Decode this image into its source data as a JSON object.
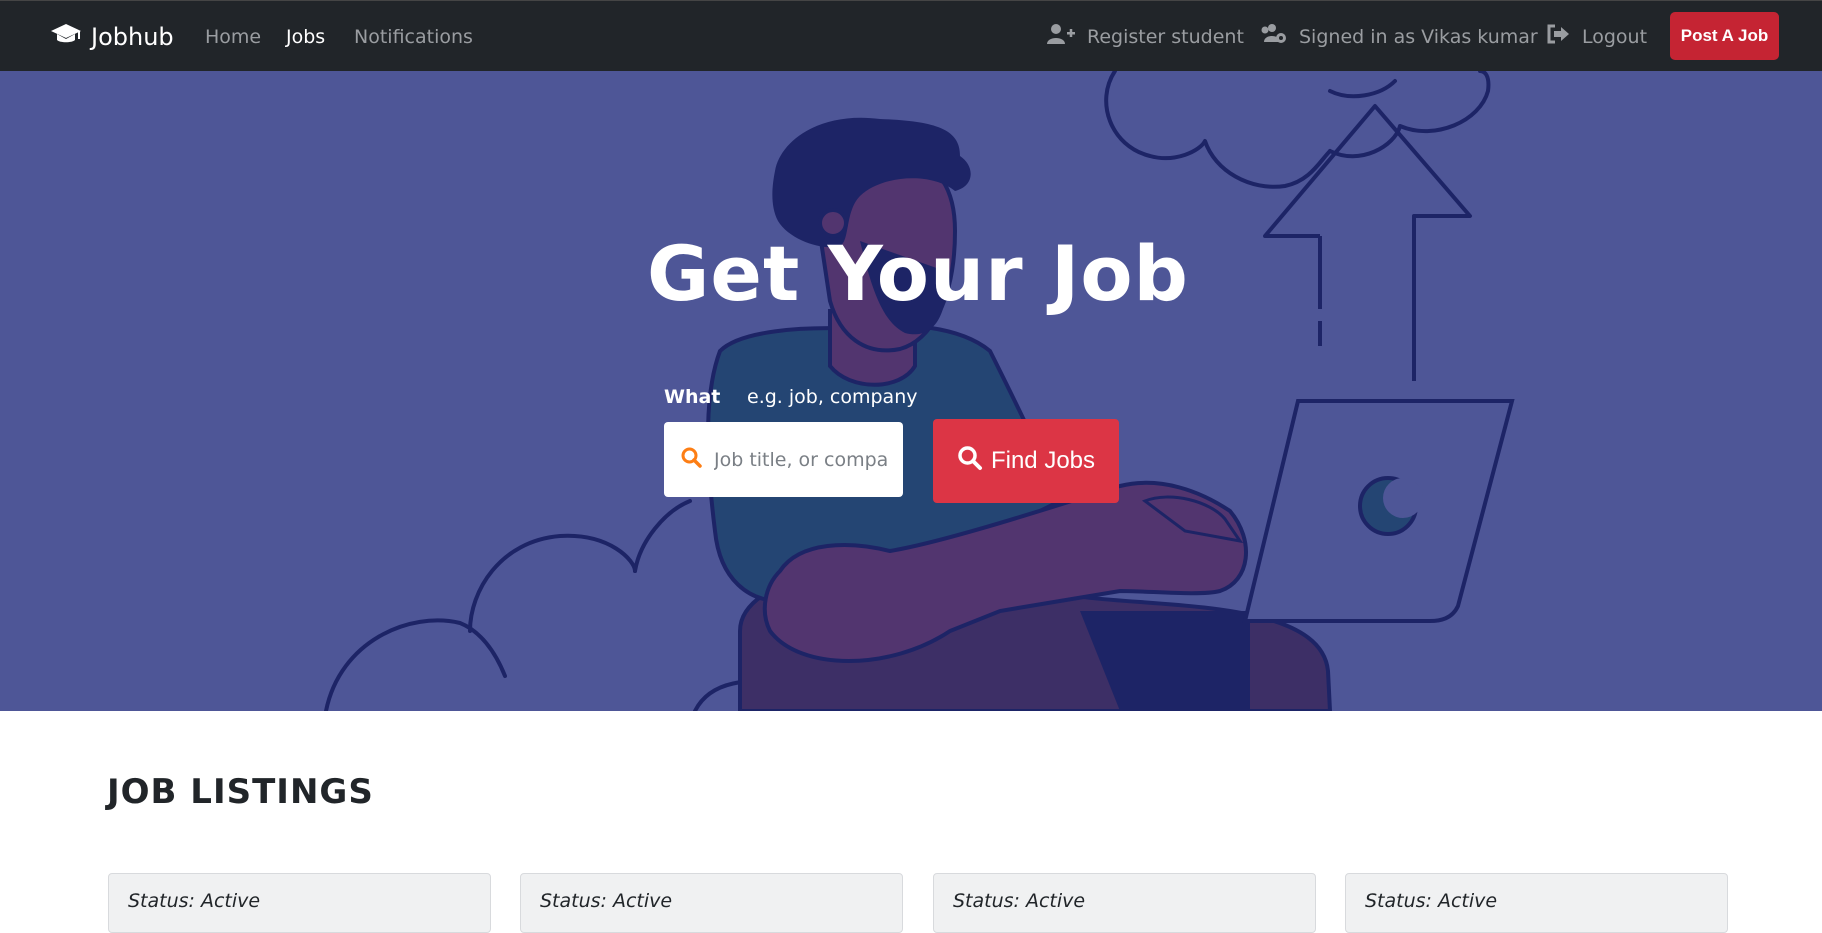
{
  "navbar": {
    "brand": "Jobhub",
    "links": [
      "Home",
      "Jobs",
      "Notifications"
    ],
    "active_link": "Jobs",
    "register": "Register student",
    "signed_in": "Signed in as Vikas kumar",
    "logout": "Logout",
    "post_job": "Post A Job"
  },
  "hero": {
    "title": "Get Your Job",
    "what_label": "What",
    "what_hint": "e.g. job, company",
    "search_placeholder": "Job title, or company",
    "find_button": "Find Jobs"
  },
  "listings": {
    "title": "JOB LISTINGS",
    "cards": [
      {
        "status": "Status: Active"
      },
      {
        "status": "Status: Active"
      },
      {
        "status": "Status: Active"
      },
      {
        "status": "Status: Active"
      }
    ]
  },
  "colors": {
    "navbar": "#212529",
    "hero_bg": "#4e5697",
    "accent_red": "#dc3545",
    "post_button": "#c52433",
    "search_icon": "#fd7e14"
  },
  "icons": [
    "graduation-cap-icon",
    "user-plus-icon",
    "users-cog-icon",
    "sign-out-icon",
    "search-icon"
  ]
}
